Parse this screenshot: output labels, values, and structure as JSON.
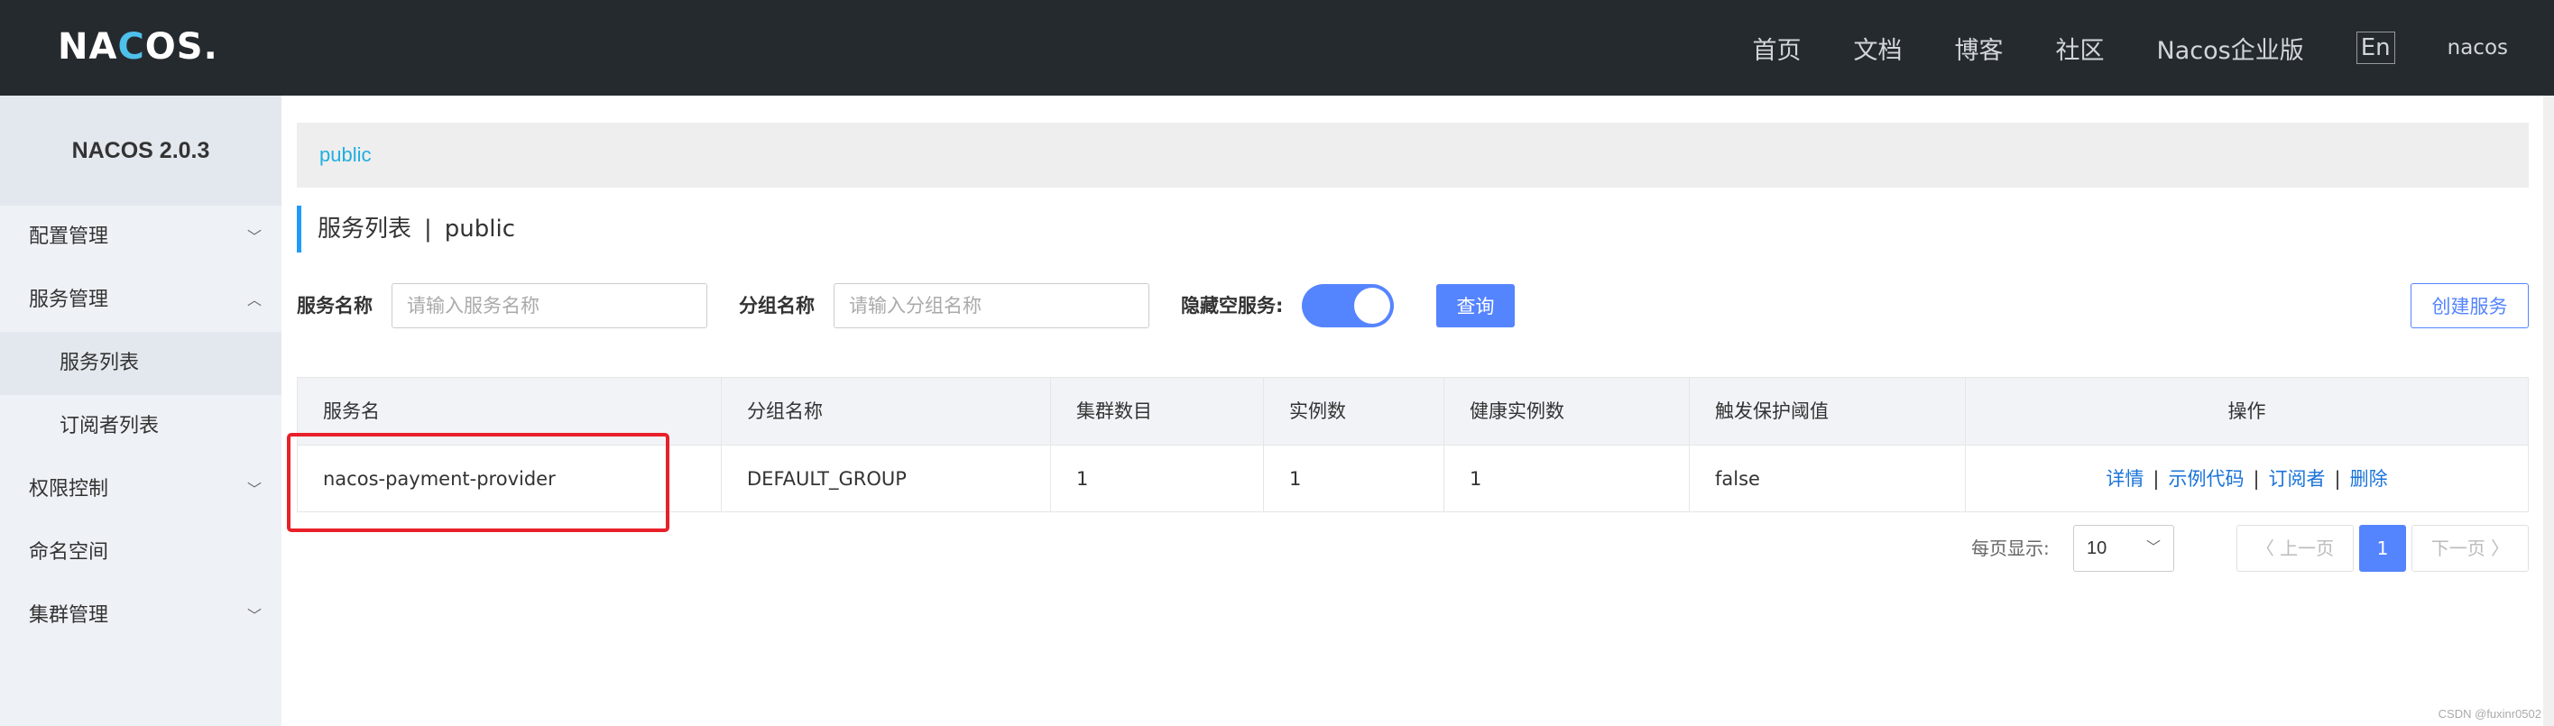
{
  "header": {
    "logo_prefix": "NA",
    "logo_c": "C",
    "logo_suffix": "OS.",
    "nav": [
      "首页",
      "文档",
      "博客",
      "社区",
      "Nacos企业版"
    ],
    "lang": "En",
    "user": "nacos"
  },
  "sidebar": {
    "version": "NACOS 2.0.3",
    "config": "配置管理",
    "service": "服务管理",
    "service_list": "服务列表",
    "subscribers": "订阅者列表",
    "auth": "权限控制",
    "namespace": "命名空间",
    "cluster": "集群管理"
  },
  "main": {
    "namespace": "public",
    "title": "服务列表",
    "title_sep": "|",
    "title_ns": "public",
    "filter": {
      "service_label": "服务名称",
      "service_placeholder": "请输入服务名称",
      "group_label": "分组名称",
      "group_placeholder": "请输入分组名称",
      "hide_empty_label": "隐藏空服务:",
      "hide_empty_on": true,
      "query": "查询",
      "create": "创建服务"
    },
    "table": {
      "headers": [
        "服务名",
        "分组名称",
        "集群数目",
        "实例数",
        "健康实例数",
        "触发保护阈值",
        "操作"
      ],
      "rows": [
        {
          "name": "nacos-payment-provider",
          "group": "DEFAULT_GROUP",
          "clusters": "1",
          "instances": "1",
          "healthy": "1",
          "threshold": "false",
          "ops": [
            "详情",
            "示例代码",
            "订阅者",
            "删除"
          ]
        }
      ]
    },
    "pagination": {
      "label": "每页显示:",
      "page_size": "10",
      "prev": "上一页",
      "current": "1",
      "next": "下一页"
    }
  },
  "watermark": "CSDN @fuxinr0502",
  "colors": {
    "accent": "#5584ff",
    "highlight": "#e8202a",
    "topbar": "#252a2f"
  }
}
